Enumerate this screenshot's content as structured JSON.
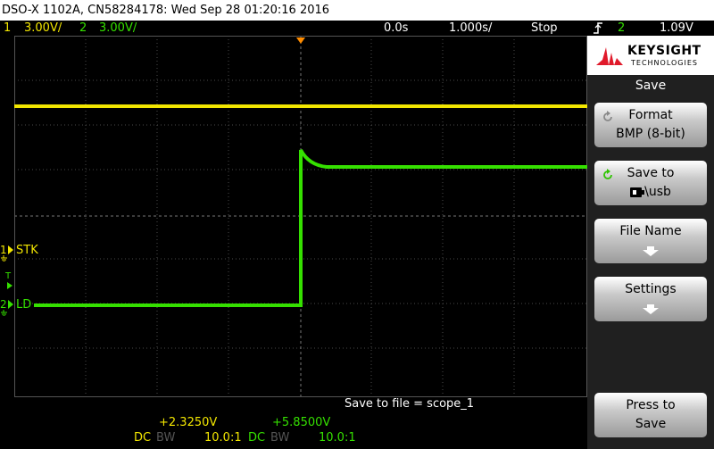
{
  "title": "DSO-X 1102A, CN58284178: Wed Sep 28 01:20:16 2016",
  "status": {
    "ch1_num": "1",
    "ch1_scale": "3.00V/",
    "ch2_num": "2",
    "ch2_scale": "3.00V/",
    "time_offset": "0.0s",
    "time_scale": "1.000s/",
    "run_state": "Stop",
    "trigger_icon": "trigger-edge-icon",
    "trigger_channel": "2",
    "trigger_level": "1.09V"
  },
  "traces": {
    "ch1_label": "STK",
    "ch2_label": "LD",
    "ch1_color": "#f2e600",
    "ch2_color": "#35e000"
  },
  "bottom": {
    "save_message": "Save to file =  scope_1",
    "ch1_value": "+2.3250V",
    "ch2_value": "+5.8500V",
    "ch1_coupling": "DC",
    "ch1_bw": "BW",
    "ch1_probe": "10.0:1",
    "ch2_coupling": "DC",
    "ch2_bw": "BW",
    "ch2_probe": "10.0:1"
  },
  "softkeys": {
    "brand": "KEYSIGHT",
    "brand_sub": "TECHNOLOGIES",
    "menu_title": "Save",
    "format_label": "Format",
    "format_value": "BMP (8-bit)",
    "saveto_label": "Save to",
    "saveto_value": "\\usb",
    "filename_label": "File Name",
    "settings_label": "Settings",
    "press_label": "Press to",
    "press_label2": "Save"
  }
}
